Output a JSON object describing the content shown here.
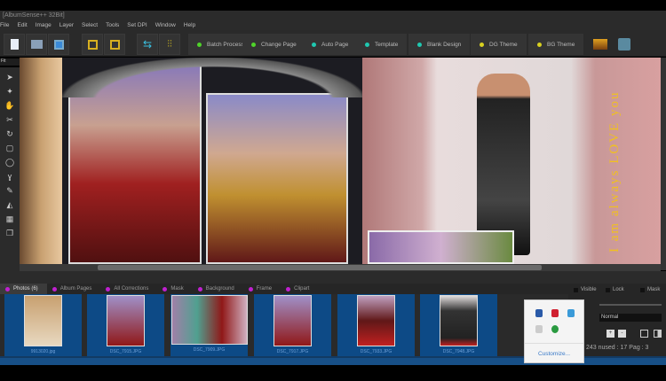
{
  "window": {
    "title": "[AlbumSense++ 32Bit]"
  },
  "menu": [
    "File",
    "Edit",
    "Image",
    "Layer",
    "Select",
    "Tools",
    "Set DPI",
    "Window",
    "Help"
  ],
  "toolbar": {
    "buttons": [
      {
        "label": "Batch Process",
        "color": "#4fd32a"
      },
      {
        "label": "Change Page",
        "color": "#4fd32a"
      },
      {
        "label": "Auto Page",
        "color": "#1fc8b0"
      },
      {
        "label": "Template",
        "color": "#1fc8b0"
      },
      {
        "label": "Blank Design",
        "color": "#1fc8b0"
      },
      {
        "label": "DG Theme",
        "color": "#d8d020"
      },
      {
        "label": "BG Theme",
        "color": "#d8d020"
      }
    ]
  },
  "zoom_select": "Fit",
  "canvas": {
    "vertical_text": "I am always LOVE you"
  },
  "tabs": [
    "Photos (6)",
    "Album Pages",
    "All Corrections",
    "Mask",
    "Background",
    "Frame",
    "Clipart"
  ],
  "photos": [
    "9913020.jpg",
    "DSC_7915.JPG",
    "DSC_7909.JPG",
    "DSC_7917.JPG",
    "DSC_7933.JPG",
    "DSC_7948.JPG"
  ],
  "layers": {
    "visible": "Visible",
    "lock": "Lock",
    "mask": "Mask",
    "blend_mode": "Normal",
    "status": "243 nused : 17 Pag : 3"
  },
  "popup": {
    "customize": "Customize..."
  }
}
